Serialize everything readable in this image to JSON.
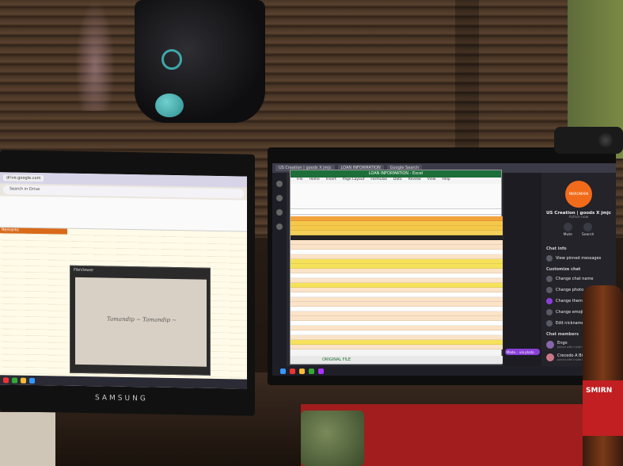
{
  "scene": {
    "left_monitor": {
      "brand": "SAMSUNG",
      "browser_tab": "drive.google.com",
      "search_placeholder": "Search in Drive",
      "sheet_column_header": "Remarks",
      "viewer_title": "FileViewer",
      "viewer_scribble": "Tamandip ~ Tamandip ~"
    },
    "right_monitor": {
      "chrome_tabs": [
        "US Creation | goods X jmjc",
        "LOAN INFORMATION",
        "Google Search"
      ],
      "excel": {
        "title": "LOAN INFORMATION - Excel",
        "menu": [
          "File",
          "Home",
          "Insert",
          "Page Layout",
          "Formulas",
          "Data",
          "Review",
          "View",
          "Help"
        ],
        "sheet_tab": "ORIGINAL FILE"
      },
      "chat": {
        "avatar_text": "MIKROMARK",
        "name": "US Creation | goods X jmjc",
        "status": "Active now",
        "actions": [
          "Mute",
          "Search"
        ],
        "chat_info": "Chat info",
        "view_pinned": "View pinned messages",
        "customize_chat": "Customize chat",
        "customize_items": [
          "Change chat name",
          "Change photo",
          "Change theme",
          "Change emoji",
          "Edit nicknames"
        ],
        "chat_members": "Chat members",
        "members": [
          {
            "name": "Engo",
            "sub": "Joined with invite link"
          },
          {
            "name": "Crecedo A Bien",
            "sub": "Joined with invite link"
          }
        ],
        "bubble": "Mode... via photo"
      }
    },
    "bottle": {
      "brand": "SMIRN"
    }
  }
}
